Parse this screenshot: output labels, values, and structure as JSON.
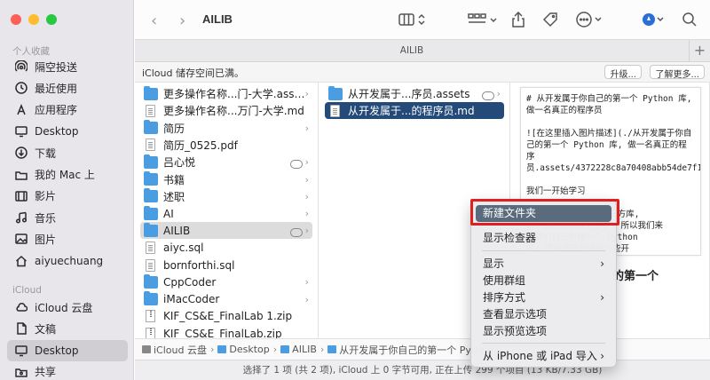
{
  "sidebar": {
    "section_favorites": "个人收藏",
    "favorites": [
      {
        "label": "隔空投送",
        "icon": "airdrop-icon"
      },
      {
        "label": "最近使用",
        "icon": "clock-icon"
      },
      {
        "label": "应用程序",
        "icon": "apps-icon"
      },
      {
        "label": "Desktop",
        "icon": "desktop-icon"
      },
      {
        "label": "下载",
        "icon": "download-icon"
      },
      {
        "label": "我的 Mac 上",
        "icon": "folder-icon"
      },
      {
        "label": "影片",
        "icon": "film-icon"
      },
      {
        "label": "音乐",
        "icon": "music-icon"
      },
      {
        "label": "图片",
        "icon": "photo-icon"
      },
      {
        "label": "aiyuechuang",
        "icon": "home-icon"
      }
    ],
    "section_icloud": "iCloud",
    "icloud": [
      {
        "label": "iCloud 云盘",
        "icon": "cloud-icon"
      },
      {
        "label": "文稿",
        "icon": "document-icon"
      },
      {
        "label": "Desktop",
        "icon": "desktop-icon"
      },
      {
        "label": "共享",
        "icon": "shared-folder-icon"
      }
    ]
  },
  "toolbar": {
    "title": "AILIB"
  },
  "tabbar": {
    "title": "AILIB",
    "plus": "+"
  },
  "icloud_bar": {
    "message": "iCloud 储存空间已满。",
    "upgrade": "升级...",
    "learn_more": "了解更多..."
  },
  "column1": [
    {
      "label": "更多操作名称...门-大学.assets",
      "type": "folder",
      "arrow": true
    },
    {
      "label": "更多操作名称...万门-大学.md",
      "type": "doc"
    },
    {
      "label": "简历",
      "type": "folder",
      "arrow": true
    },
    {
      "label": "简历_0525.pdf",
      "type": "doc"
    },
    {
      "label": "吕心悦",
      "type": "folder",
      "cloud": true,
      "arrow": true
    },
    {
      "label": "书籍",
      "type": "folder",
      "arrow": true
    },
    {
      "label": "述职",
      "type": "folder",
      "arrow": true
    },
    {
      "label": "AI",
      "type": "folder",
      "arrow": true
    },
    {
      "label": "AILIB",
      "type": "folder",
      "cloud": true,
      "arrow": true,
      "selected": true
    },
    {
      "label": "aiyc.sql",
      "type": "doc"
    },
    {
      "label": "bornforthi.sql",
      "type": "doc"
    },
    {
      "label": "CppCoder",
      "type": "folder",
      "arrow": true
    },
    {
      "label": "iMacCoder",
      "type": "folder",
      "arrow": true
    },
    {
      "label": "KIF_CS&E_FinalLab 1.zip",
      "type": "zip"
    },
    {
      "label": "KIF_CS&E_FinalLab.zip",
      "type": "zip"
    }
  ],
  "column2": [
    {
      "label": "从开发属于...序员.assets",
      "type": "folder",
      "cloud": true,
      "arrow": true
    },
    {
      "label": "从开发属于...的程序员.md",
      "type": "doc",
      "selected": true
    }
  ],
  "preview": {
    "text": "# 从开发属于你自己的第一个 Python 库, 做一名真正的程序员\n\n![在这里插入图片描述](./从开发属于你自己的第一个 Python 库, 做一名真正的程序员.assets/4372228c8a70408abb54de7f17bc58fb.3762caaf.png)\n\n我们一开始学习\n\n用过不少 Python 第三方库,\n是不是觉得过程太少了, 所以我们来\n让我们自己创建一个 Python\n库, 团队还是在线的一些开",
    "heading": "的第一个"
  },
  "pathbar": [
    "iCloud 云盘",
    "Desktop",
    "AILIB",
    "从开发属于你自己的第一个 Python"
  ],
  "statusbar": {
    "text": "选择了 1 项 (共 2 项), iCloud 上 0 字节可用, 正在上传 299 个项目 (13 KB/7.33 GB)"
  },
  "context_menu": {
    "items": [
      {
        "label": "新建文件夹",
        "highlighted": true
      },
      {
        "label": "显示检查器"
      },
      {
        "label": "显示",
        "submenu": true
      },
      {
        "label": "使用群组"
      },
      {
        "label": "排序方式",
        "submenu": true
      },
      {
        "label": "查看显示选项"
      },
      {
        "label": "显示预览选项"
      },
      {
        "label": "从 iPhone 或 iPad 导入",
        "submenu": true
      }
    ]
  }
}
